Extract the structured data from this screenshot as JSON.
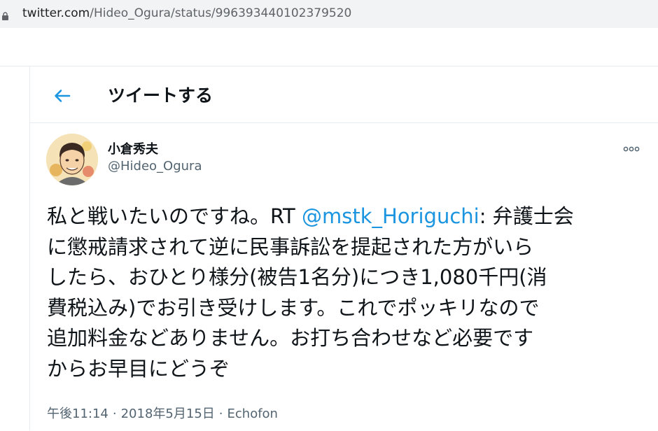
{
  "browser": {
    "url_host": "twitter.com",
    "url_path": "/Hideo_Ogura/status/996393440102379520"
  },
  "header": {
    "back_icon": "arrow-left-icon",
    "title": "ツイートする"
  },
  "tweet": {
    "author_name": "小倉秀夫",
    "author_handle": "@Hideo_Ogura",
    "more_icon": "more-dots-icon",
    "lines": [
      {
        "pre": "私と戦いたいのですね。RT ",
        "mention": "@mstk_Horiguchi",
        "post": ": 弁護士会"
      },
      {
        "text": "に懲戒請求されて逆に民事訴訟を提起された方がいら"
      },
      {
        "text": "したら、おひとり様分(被告1名分)につき1,080千円(消"
      },
      {
        "text": "費税込み)でお引き受けします。これでポッキリなので"
      },
      {
        "text": "追加料金などありません。お打ち合わせなど必要です"
      },
      {
        "text": "からお早目にどうぞ"
      }
    ],
    "time": "午後11:14",
    "date": "2018年5月15日",
    "separator": "·",
    "source": "Echofon"
  },
  "colors": {
    "accent": "#1b95e0",
    "text_primary": "#0f1419",
    "text_secondary": "#536471",
    "border": "#e6ecf0",
    "address_bar_bg": "#f1f3f4"
  }
}
